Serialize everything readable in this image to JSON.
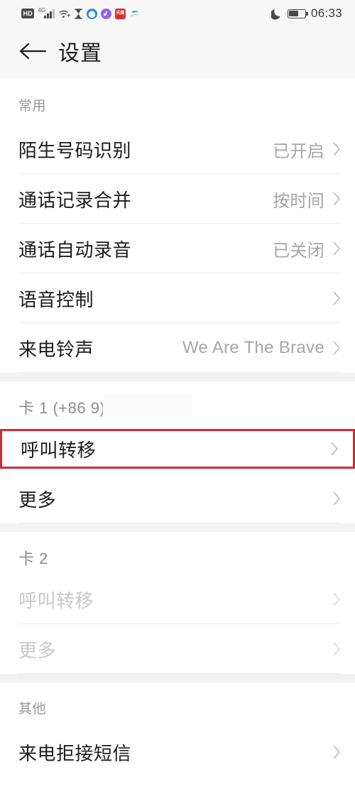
{
  "status_bar": {
    "hd_badge": "HD",
    "network_label": "4G",
    "icons": [
      "hd-badge",
      "signal-bars",
      "wifi-icon",
      "hourglass-icon",
      "app-circle-blue-icon",
      "app-music-icon",
      "app-red-icon",
      "app-swoosh-icon"
    ],
    "right_icons": [
      "moon-icon",
      "battery-icon"
    ],
    "battery_percent": 60,
    "time": "06:33"
  },
  "header": {
    "back_icon": "back-arrow-icon",
    "title": "设置"
  },
  "sections": [
    {
      "header": "常用",
      "rows": [
        {
          "label": "陌生号码识别",
          "value": "已开启",
          "disabled": false,
          "highlight": false
        },
        {
          "label": "通话记录合并",
          "value": "按时间",
          "disabled": false,
          "highlight": false
        },
        {
          "label": "通话自动录音",
          "value": "已关闭",
          "disabled": false,
          "highlight": false
        },
        {
          "label": "语音控制",
          "value": "",
          "disabled": false,
          "highlight": false
        },
        {
          "label": "来电铃声",
          "value": "We Are The Brave",
          "disabled": false,
          "highlight": false
        }
      ]
    },
    {
      "header": "卡 1 (+86                    9)",
      "sim": true,
      "redacted": true,
      "rows": [
        {
          "label": "呼叫转移",
          "value": "",
          "disabled": false,
          "highlight": true
        },
        {
          "label": "更多",
          "value": "",
          "disabled": false,
          "highlight": false
        }
      ]
    },
    {
      "header": "卡 2",
      "sim": true,
      "redacted": false,
      "rows": [
        {
          "label": "呼叫转移",
          "value": "",
          "disabled": true,
          "highlight": false
        },
        {
          "label": "更多",
          "value": "",
          "disabled": true,
          "highlight": false
        }
      ]
    },
    {
      "header": "其他",
      "rows": [
        {
          "label": "来电拒接短信",
          "value": "",
          "disabled": false,
          "highlight": false
        }
      ]
    }
  ],
  "colors": {
    "highlight_border": "#d42b3a",
    "background": "#ffffff",
    "header_background": "#f7f7f7",
    "divider": "#ededed",
    "section_gap": "#f2f2f2",
    "label": "#1c1c1c",
    "value": "#a6a6a6",
    "disabled": "#c9c9c9"
  }
}
